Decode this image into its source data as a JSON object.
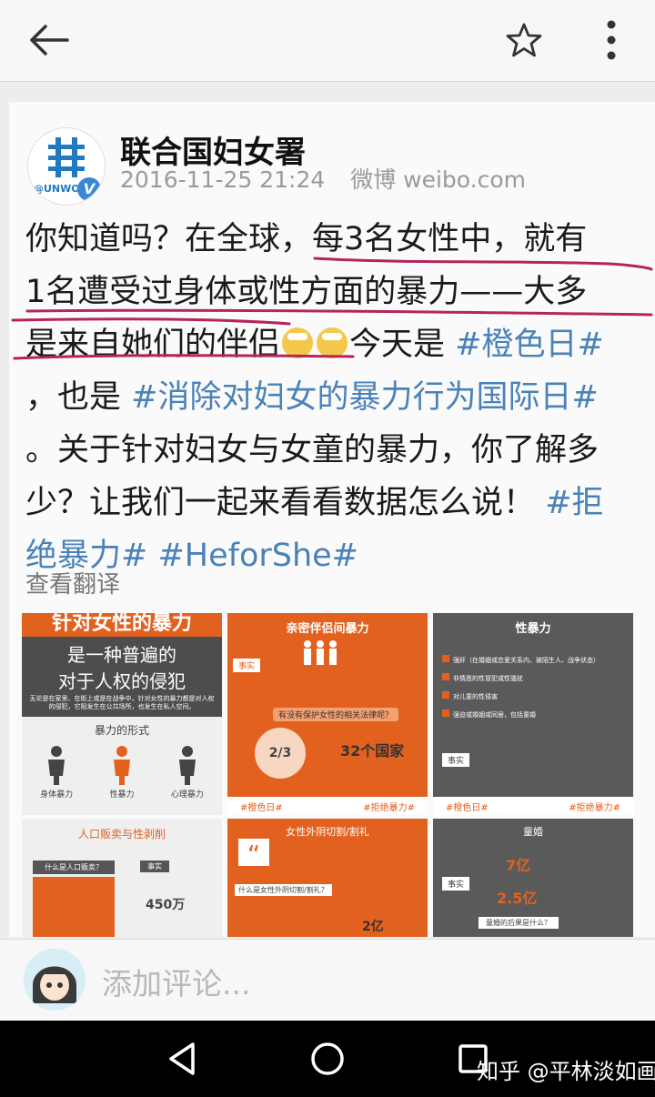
{
  "post": {
    "author": "联合国妇女署",
    "avatar_label": "@UNWO",
    "verified_mark": "V",
    "timestamp": "2016-11-25 21:24",
    "source": "微博 weibo.com",
    "lines": [
      [
        "你知道吗？在全球，每3名女性中，就有"
      ],
      [
        "1名遭受过身体或性方面的暴力——大多"
      ],
      [
        "是来自她们的伴侣",
        "今天是 ",
        "#橙色日#"
      ],
      [
        "，也是 ",
        "#消除对妇女的暴力行为国际日#"
      ],
      [
        "。关于针对妇女与女童的暴力，你了解多"
      ],
      [
        "少？让我们一起来看看数据怎么说！ ",
        "#拒"
      ],
      [
        "绝暴力# #HeforShe#"
      ]
    ],
    "translate_label": "查看翻译"
  },
  "infographics": {
    "tile1": {
      "title_top": "针对女性的暴力",
      "title_main": "是一种普遍的",
      "title_sub": "对于人权的侵犯",
      "desc": "无论是在家里、在街上或是在战争中，针对女性的暴力都是对人权的侵犯，它阻发生在公共场所，也发生在私人空间。",
      "forms_title": "暴力的形式",
      "forms": [
        "身体暴力",
        "性暴力",
        "心理暴力"
      ]
    },
    "tile2": {
      "title": "亲密伴侣间暴力",
      "fact": "事实",
      "question": "有没有保护女性的相关法律呢？",
      "fraction": "2/3",
      "countries": "32个国家",
      "footer_left": "#橙色日#",
      "footer_right": "#拒绝暴力#"
    },
    "tile3": {
      "title": "性暴力",
      "items": [
        "强奸（在婚姻或恋爱关系内、被陌生人、战争状态）",
        "非情愿的性冒犯或性骚扰",
        "对儿童的性侵害",
        "强迫或婚姻或同居，包括童婚"
      ],
      "fact": "事实",
      "footer_left": "#橙色日#",
      "footer_right": "#拒绝暴力#"
    },
    "tile4": {
      "title": "人口贩卖与性剥削",
      "question": "什么是人口贩卖？",
      "fact": "事实",
      "number": "450万"
    },
    "tile5": {
      "title": "女性外阴切割/割礼",
      "quote_mark": "“",
      "question": "什么是女性外阴切割/割礼？",
      "number": "2亿"
    },
    "tile6": {
      "title": "童婚",
      "fact": "事实",
      "number1": "7亿",
      "number2": "2.5亿",
      "question": "童婚的后果是什么？"
    }
  },
  "comment": {
    "placeholder": "添加评论..."
  },
  "watermark": "知乎 @平林淡如画"
}
